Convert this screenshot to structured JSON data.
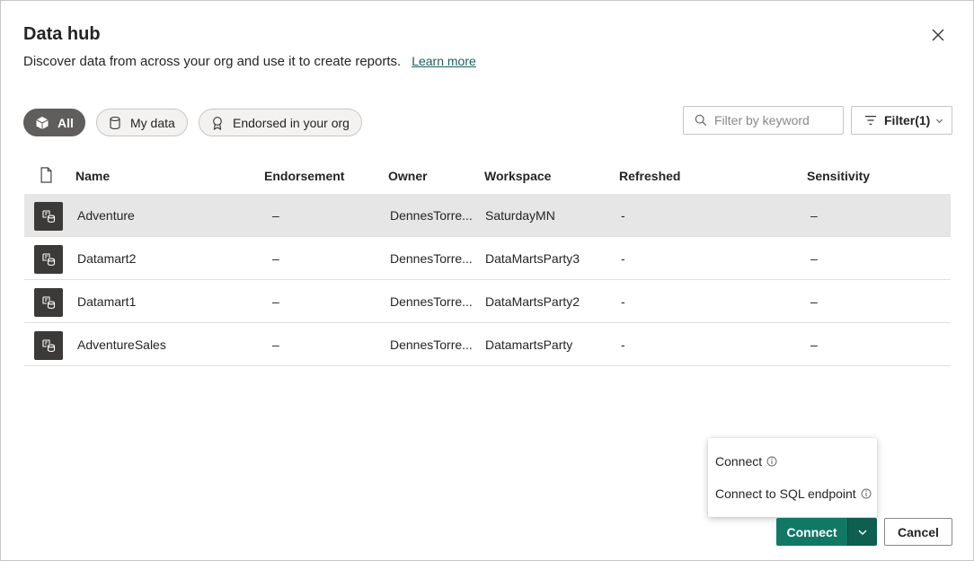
{
  "dialog": {
    "title": "Data hub",
    "subtitle": "Discover data from across your org and use it to create reports.",
    "learn_more": "Learn more",
    "close_icon": "close-icon"
  },
  "filters": {
    "all": "All",
    "my_data": "My data",
    "endorsed": "Endorsed in your org",
    "active": "all"
  },
  "search": {
    "placeholder": "Filter by keyword",
    "value": ""
  },
  "filter_button": {
    "label": "Filter(1)"
  },
  "table": {
    "columns": {
      "name": "Name",
      "endorsement": "Endorsement",
      "owner": "Owner",
      "workspace": "Workspace",
      "refreshed": "Refreshed",
      "sensitivity": "Sensitivity"
    },
    "rows": [
      {
        "name": "Adventure",
        "endorsement": "–",
        "owner": "DennesTorre...",
        "workspace": "SaturdayMN",
        "refreshed": "-",
        "sensitivity": "–",
        "selected": true
      },
      {
        "name": "Datamart2",
        "endorsement": "–",
        "owner": "DennesTorre...",
        "workspace": "DataMartsParty3",
        "refreshed": "-",
        "sensitivity": "–",
        "selected": false
      },
      {
        "name": "Datamart1",
        "endorsement": "–",
        "owner": "DennesTorre...",
        "workspace": "DataMartsParty2",
        "refreshed": "-",
        "sensitivity": "–",
        "selected": false
      },
      {
        "name": "AdventureSales",
        "endorsement": "–",
        "owner": "DennesTorre...",
        "workspace": "DatamartsParty",
        "refreshed": "-",
        "sensitivity": "–",
        "selected": false
      }
    ]
  },
  "connect_menu": {
    "items": [
      "Connect",
      "Connect to SQL endpoint"
    ]
  },
  "footer": {
    "connect": "Connect",
    "cancel": "Cancel"
  },
  "colors": {
    "primary": "#117865",
    "primary_dark": "#0e5f50",
    "pill_active": "#605e5c",
    "row_selected": "#e6e6e6",
    "link": "#1b5e5c"
  }
}
